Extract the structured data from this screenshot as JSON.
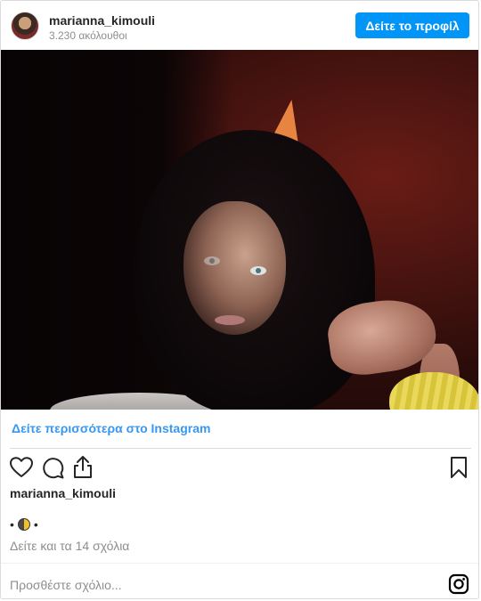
{
  "header": {
    "username": "marianna_kimouli",
    "followers": "3.230 ακόλουθοι",
    "view_profile_label": "Δείτε το προφίλ"
  },
  "post": {
    "more_link": "Δείτε περισσότερα στο Instagram",
    "owner": "marianna_kimouli",
    "caption": {
      "before": "•",
      "emoji": "half-moon-emoji",
      "after": "•"
    },
    "view_comments": "Δείτε και τα 14 σχόλια",
    "add_comment_placeholder": "Προσθέστε σχόλιο..."
  },
  "icons": [
    "heart-icon",
    "comment-icon",
    "share-icon",
    "bookmark-icon",
    "instagram-logo-icon"
  ],
  "colors": {
    "accent": "#0095f6",
    "link": "#3897f0",
    "muted": "#8e8e8e",
    "text": "#262626",
    "border": "#dbdbdb"
  }
}
